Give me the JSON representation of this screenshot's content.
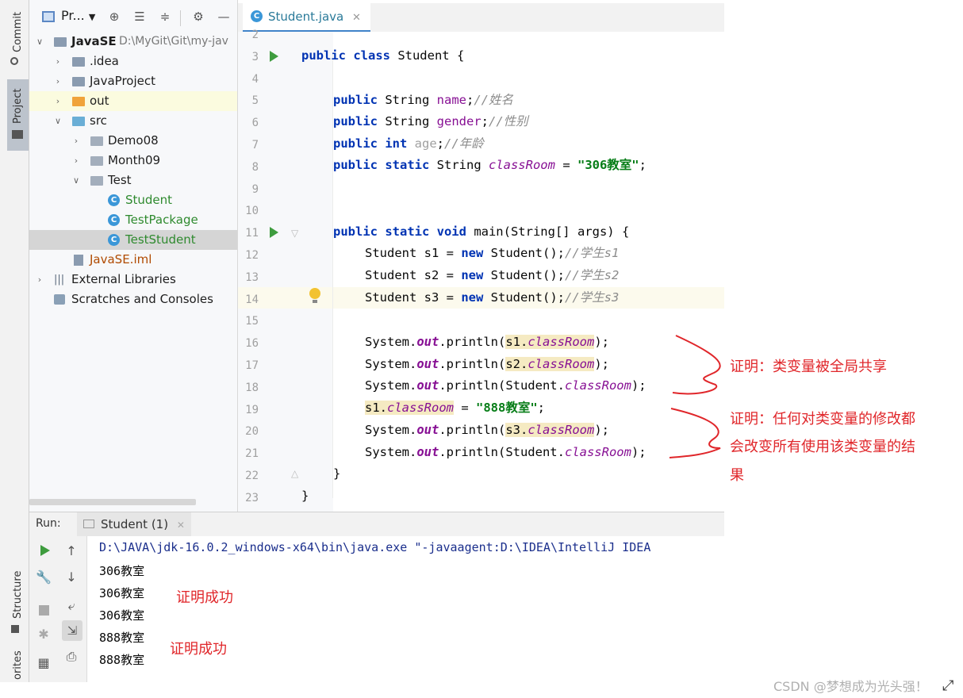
{
  "left_strip": {
    "commit_label": "Commit",
    "project_label": "Project",
    "structure_label": "Structure",
    "favorites_label": "orites"
  },
  "project_panel": {
    "title": "Pr...",
    "tree": [
      {
        "label": "JavaSE",
        "path": "D:\\MyGit\\Git\\my-jav",
        "bold": true
      },
      {
        "label": ".idea"
      },
      {
        "label": "JavaProject"
      },
      {
        "label": "out"
      },
      {
        "label": "src"
      },
      {
        "label": "Demo08"
      },
      {
        "label": "Month09"
      },
      {
        "label": "Test"
      },
      {
        "label": "Student"
      },
      {
        "label": "TestPackage"
      },
      {
        "label": "TestStudent"
      },
      {
        "label": "JavaSE.iml"
      },
      {
        "label": "External Libraries"
      },
      {
        "label": "Scratches and Consoles"
      }
    ]
  },
  "editor": {
    "tab_label": "Student.java",
    "line_numbers": [
      "2",
      "3",
      "4",
      "5",
      "6",
      "7",
      "8",
      "9",
      "10",
      "11",
      "12",
      "13",
      "14",
      "15",
      "16",
      "17",
      "18",
      "19",
      "20",
      "21",
      "22",
      "23"
    ]
  },
  "annotations": {
    "note1": "证明：类变量被全局共享",
    "note2_line1": "证明：任何对类变量的修改都",
    "note2_line2": "会改变所有使用该类变量的结",
    "note2_line3": "果",
    "success1": "证明成功",
    "success2": "证明成功"
  },
  "run_panel": {
    "run_label": "Run:",
    "tab_label": "Student (1)",
    "command": "D:\\JAVA\\jdk-16.0.2_windows-x64\\bin\\java.exe \"-javaagent:D:\\IDEA\\IntelliJ IDEA",
    "outputs": [
      "306教室",
      "306教室",
      "306教室",
      "888教室",
      "888教室"
    ]
  },
  "watermark": "CSDN @梦想成为光头强！",
  "colors": {
    "keyword": "#0033b3",
    "field": "#871094",
    "string": "#067d17",
    "comment": "#8c8c8c",
    "annotation": "#e0262a"
  }
}
